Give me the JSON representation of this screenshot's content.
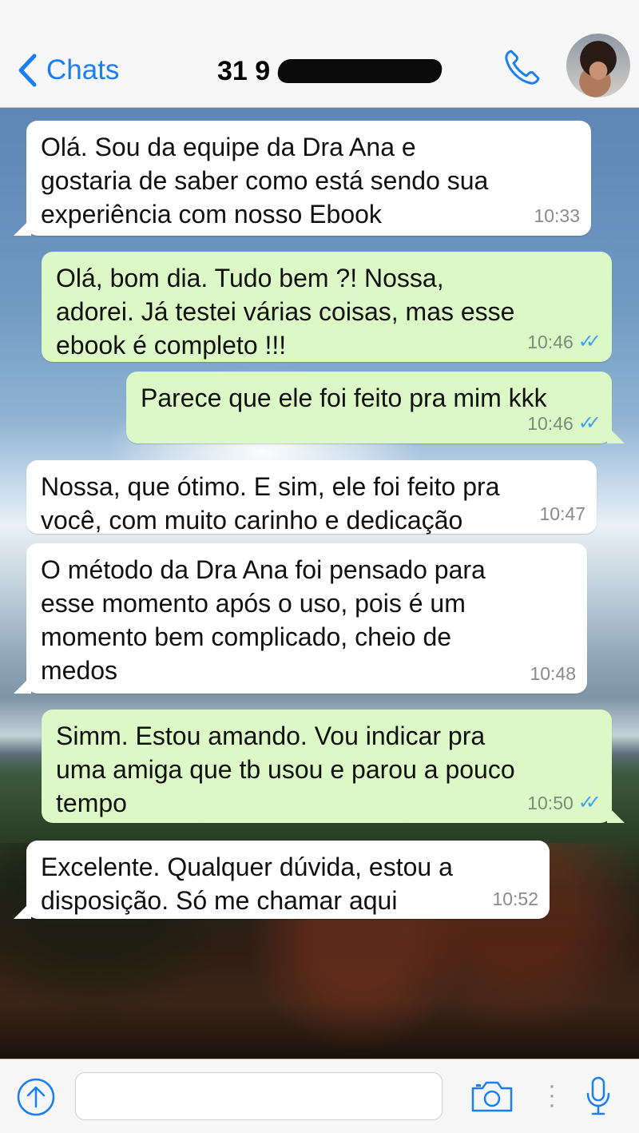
{
  "header": {
    "back_label": "Chats",
    "contact_name_visible": "31 9"
  },
  "messages": [
    {
      "direction": "in",
      "text": "Olá. Sou da equipe da Dra Ana e\ngostaria de saber como está sendo sua\nexperiência com nosso Ebook",
      "time": "10:33",
      "read": false
    },
    {
      "direction": "out",
      "text": "Olá, bom dia. Tudo bem ?! Nossa,\nadorei. Já testei várias coisas, mas esse\nebook é completo !!!",
      "time": "10:46",
      "read": true
    },
    {
      "direction": "out",
      "text": "Parece que ele foi feito pra mim kkk",
      "time": "10:46",
      "read": true
    },
    {
      "direction": "in",
      "text": "Nossa, que ótimo. E sim, ele foi feito pra\nvocê, com muito carinho e dedicação",
      "time": "10:47",
      "read": false
    },
    {
      "direction": "in",
      "text": "O método da Dra Ana foi pensado para\nesse momento após o uso, pois é um\nmomento bem complicado, cheio de\nmedos",
      "time": "10:48",
      "read": false
    },
    {
      "direction": "out",
      "text": "Simm. Estou amando. Vou indicar pra\numa amiga que tb usou e parou a pouco\ntempo",
      "time": "10:50",
      "read": true
    },
    {
      "direction": "in",
      "text": "Excelente. Qualquer dúvida, estou a\ndisposição. Só me chamar aqui",
      "time": "10:52",
      "read": false
    }
  ],
  "ticks_glyph": "✓✓",
  "icons": {
    "back": "chevron-left-icon",
    "call": "phone-icon",
    "attach": "arrow-up-circle-icon",
    "camera": "camera-icon",
    "mic": "microphone-icon"
  },
  "colors": {
    "accent": "#1a7ef5",
    "incoming_bubble": "#ffffff",
    "outgoing_bubble": "#dcf8c6",
    "read_ticks": "#40a4ea"
  }
}
